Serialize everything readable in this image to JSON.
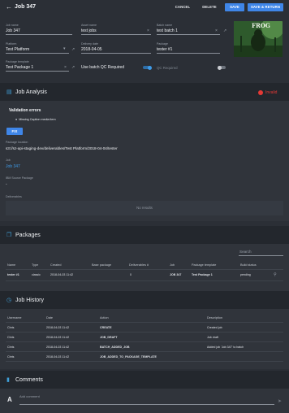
{
  "header": {
    "title": "Job 347",
    "cancel": "CANCEL",
    "delete": "DELETE",
    "save": "SAVE",
    "save_return": "SAVE & RETURN"
  },
  "form": {
    "job_name_label": "Job name",
    "job_name": "Job 347",
    "asset_name_label": "Asset name",
    "asset_name": "test jobs",
    "batch_name_label": "Batch name",
    "batch_name": "test batch 1",
    "platform_label": "Platform",
    "platform": "Test Platform",
    "delivery_date_label": "Delivery date",
    "delivery_date": "2018-04-05",
    "package_label": "Package",
    "package": "tester #1",
    "package_template_label": "Package template",
    "package_template": "Test Package 1",
    "batch_qc_label": "Use batch QC Required",
    "qc_required_label": "QC Required",
    "thumbnail_text": "FROG"
  },
  "analysis": {
    "title": "Job Analysis",
    "status": "Invalid",
    "validation_errors_title": "Validation errors",
    "error_item": "Missing Caption media item",
    "fix_button": "FIX",
    "package_location_label": "Package location",
    "package_location": "s3://sz-api-staging-dev/deliverables/Test Platform/2018-04-04/tester",
    "job_label": "Job",
    "job_link": "Job 347",
    "ibm_label": "IBM Source Package",
    "ibm_value": "-",
    "deliverables_label": "Deliverables",
    "no_results": "No results"
  },
  "packages": {
    "title": "Packages",
    "search_placeholder": "Search",
    "columns": [
      "Name",
      "Type",
      "Created",
      "Base package",
      "Deliverables #",
      "Job",
      "Package template",
      "Build status"
    ],
    "rows": [
      [
        "tester #1",
        "classic",
        "2018-04-03 11:42",
        "",
        "0",
        "JOB 347",
        "Test Package 1",
        "pending"
      ]
    ]
  },
  "history": {
    "title": "Job History",
    "columns": [
      "Username",
      "Date",
      "Action",
      "Description"
    ],
    "rows": [
      [
        "Chris",
        "2018-04-03 11:42",
        "CREATE",
        "Created job"
      ],
      [
        "Chris",
        "2018-04-03 11:42",
        "JOB_DRAFT",
        "Job draft"
      ],
      [
        "Chris",
        "2018-04-03 11:42",
        "BATCH_ADDED_JOB",
        "Added job 'Job 347' to batch"
      ],
      [
        "Chris",
        "2018-04-03 11:42",
        "JOB_ADDED_TO_PACKAGE_TEMPLATE",
        ""
      ]
    ]
  },
  "comments": {
    "title": "Comments",
    "avatar_letter": "A",
    "add_comment_placeholder": "Add comment"
  },
  "colors": {
    "accent": "#3f86e8",
    "invalid": "#e53935",
    "section_icon": "#3fa0d8"
  }
}
